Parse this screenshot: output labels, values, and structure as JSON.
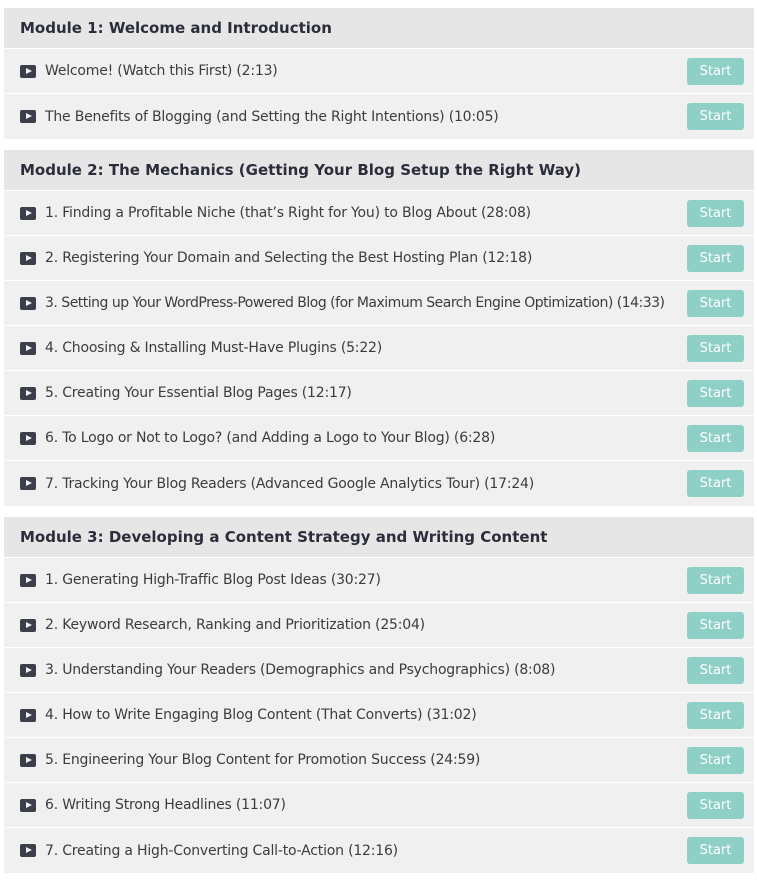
{
  "modules": [
    {
      "title": "Module 1: Welcome and Introduction",
      "lessons": [
        {
          "title": "Welcome! (Watch this First) (2:13)",
          "button": "Start"
        },
        {
          "title": "The Benefits of Blogging (and Setting the Right Intentions) (10:05)",
          "button": "Start"
        }
      ]
    },
    {
      "title": "Module 2: The Mechanics (Getting Your Blog Setup the Right Way)",
      "lessons": [
        {
          "title": "1. Finding a Profitable Niche (that’s Right for You) to Blog About (28:08)",
          "button": "Start"
        },
        {
          "title": "2. Registering Your Domain and Selecting the Best Hosting Plan (12:18)",
          "button": "Start"
        },
        {
          "title": "3. Setting up Your WordPress-Powered Blog (for Maximum Search Engine Optimization) (14:33)",
          "button": "Start"
        },
        {
          "title": "4. Choosing & Installing Must-Have Plugins (5:22)",
          "button": "Start"
        },
        {
          "title": "5. Creating Your Essential Blog Pages (12:17)",
          "button": "Start"
        },
        {
          "title": "6. To Logo or Not to Logo? (and Adding a Logo to Your Blog) (6:28)",
          "button": "Start"
        },
        {
          "title": "7. Tracking Your Blog Readers (Advanced Google Analytics Tour) (17:24)",
          "button": "Start"
        }
      ]
    },
    {
      "title": "Module 3: Developing a Content Strategy and Writing Content",
      "lessons": [
        {
          "title": "1. Generating High-Traffic Blog Post Ideas (30:27)",
          "button": "Start"
        },
        {
          "title": "2. Keyword Research, Ranking and Prioritization (25:04)",
          "button": "Start"
        },
        {
          "title": "3. Understanding Your Readers (Demographics and Psychographics) (8:08)",
          "button": "Start"
        },
        {
          "title": "4. How to Write Engaging Blog Content (That Converts) (31:02)",
          "button": "Start"
        },
        {
          "title": "5. Engineering Your Blog Content for Promotion Success (24:59)",
          "button": "Start"
        },
        {
          "title": "6. Writing Strong Headlines (11:07)",
          "button": "Start"
        },
        {
          "title": "7. Creating a High-Converting Call-to-Action (12:16)",
          "button": "Start"
        }
      ]
    }
  ],
  "icons": {
    "lesson": "video-play-icon"
  },
  "colors": {
    "button_bg": "#8ecfc6",
    "header_bg": "#e6e6e6",
    "row_bg": "#f0f0f0",
    "title_text": "#2b2d3a"
  }
}
